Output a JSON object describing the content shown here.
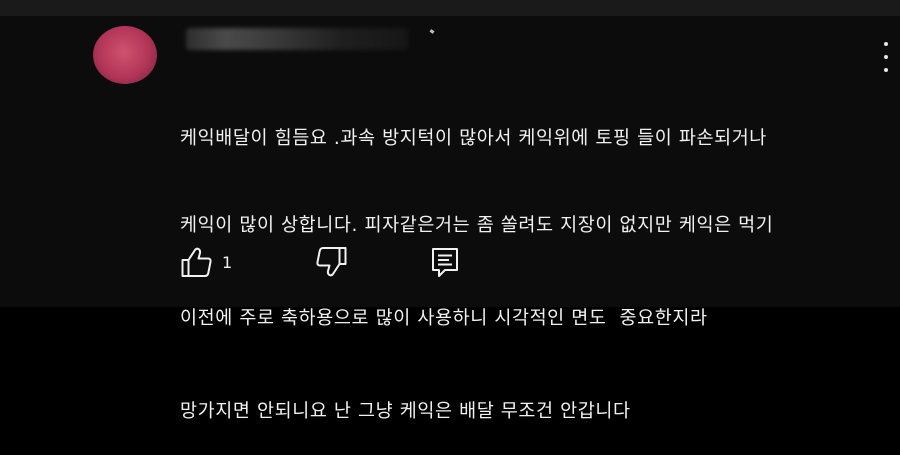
{
  "comment": {
    "body_lines": [
      "케익배달이 힘듬요 .과속 방지턱이 많아서 케익위에 토핑 들이 파손되거나",
      "케익이 많이 상합니다. 피자같은거는 좀 쏠려도 지장이 없지만 케익은 먹기",
      "이전에 주로 축하용으로 많이 사용하니 시각적인 면도  중요한지라",
      "망가지면 안되니요 난 그냥 케익은 배달 무조건 안갑니다"
    ],
    "like_count": "1"
  },
  "icons": {
    "like": "thumbs-up-icon",
    "dislike": "thumbs-down-icon",
    "reply": "reply-comment-icon",
    "more": "more-vertical-icon"
  },
  "colors": {
    "background": "#0c0c0c",
    "text": "#f1f1f1",
    "avatar": "#c2405f"
  }
}
